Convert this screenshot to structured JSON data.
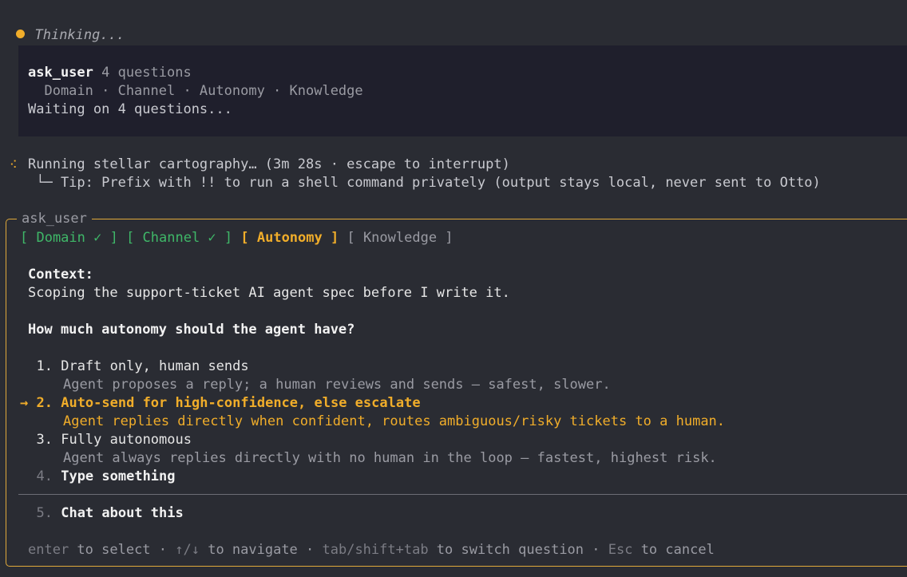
{
  "thinking": {
    "label": "Thinking..."
  },
  "tool_call": {
    "name": "ask_user",
    "summary": " 4 questions",
    "topics": "  Domain · Channel · Autonomy · Knowledge",
    "status": "Waiting on 4 questions..."
  },
  "running": {
    "icon": "spinner-dots",
    "text": "Running stellar cartography… (3m 28s · escape to interrupt)",
    "tip": " └─ Tip: Prefix with !! to run a shell command privately (output stays local, never sent to Otto)"
  },
  "panel": {
    "title": "ask_user",
    "tabs": [
      {
        "label": "[ Domain ✓ ]",
        "state": "done"
      },
      {
        "label": "[ Channel ✓ ]",
        "state": "done"
      },
      {
        "label": "[ Autonomy ]",
        "state": "active"
      },
      {
        "label": "[ Knowledge ]",
        "state": "pending"
      }
    ],
    "context_heading": "Context:",
    "context_text": "Scoping the support-ticket AI agent spec before I write it.",
    "question": "How much autonomy should the agent have?",
    "options": [
      {
        "marker": "  ",
        "number": "1.",
        "label": "Draft only, human sends",
        "description": "Agent proposes a reply; a human reviews and sends — safest, slower."
      },
      {
        "marker": "→ ",
        "number": "2.",
        "label": "Auto-send for high-confidence, else escalate",
        "description": "Agent replies directly when confident, routes ambiguous/risky tickets to a human."
      },
      {
        "marker": "  ",
        "number": "3.",
        "label": "Fully autonomous",
        "description": "Agent always replies directly with no human in the loop — fastest, highest risk."
      },
      {
        "marker": "  ",
        "number": "4.",
        "label": "Type something"
      },
      {
        "marker": "  ",
        "number": "5.",
        "label": "Chat about this"
      }
    ],
    "footer": {
      "enter_key": "enter",
      "enter_action": " to select · ",
      "nav_key": "↑/↓",
      "nav_action": " to navigate · ",
      "tab_key": "tab/shift+tab",
      "tab_action": " to switch question · ",
      "esc_key": "Esc",
      "esc_action": " to cancel"
    }
  },
  "colors": {
    "background": "#2a2c33",
    "tool_block": "#1f1f2c",
    "accent": "#f0ad2a",
    "success": "#3fb768",
    "border": "#e0a93b"
  }
}
